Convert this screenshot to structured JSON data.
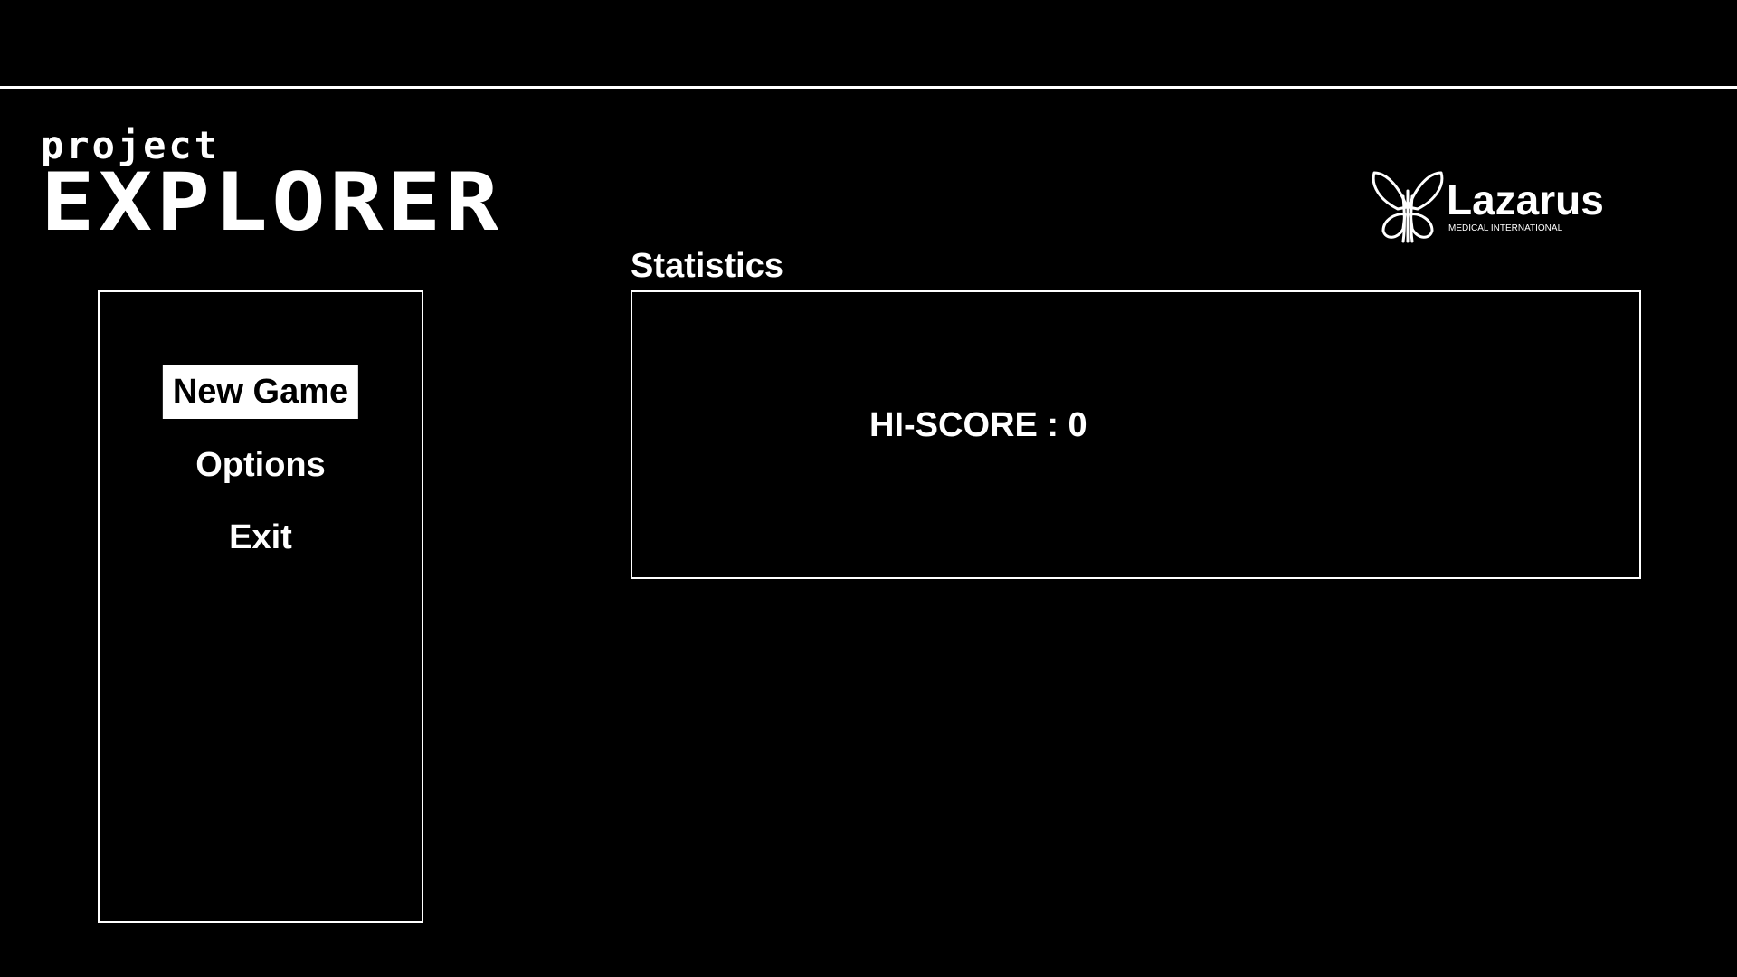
{
  "title_logo": {
    "small_text": "project",
    "big_text": "EXPLORER"
  },
  "brand": {
    "icon": "butterfly-logo-icon",
    "name": "Lazarus",
    "tagline": "MEDICAL INTERNATIONAL"
  },
  "menu": {
    "selected_index": 0,
    "items": [
      {
        "label": "New Game"
      },
      {
        "label": "Options"
      },
      {
        "label": "Exit"
      }
    ]
  },
  "statistics": {
    "heading": "Statistics",
    "hiscore_label": "HI-SCORE : 0"
  },
  "colors": {
    "background": "#000000",
    "foreground": "#ffffff",
    "selected_text": "#000000"
  }
}
